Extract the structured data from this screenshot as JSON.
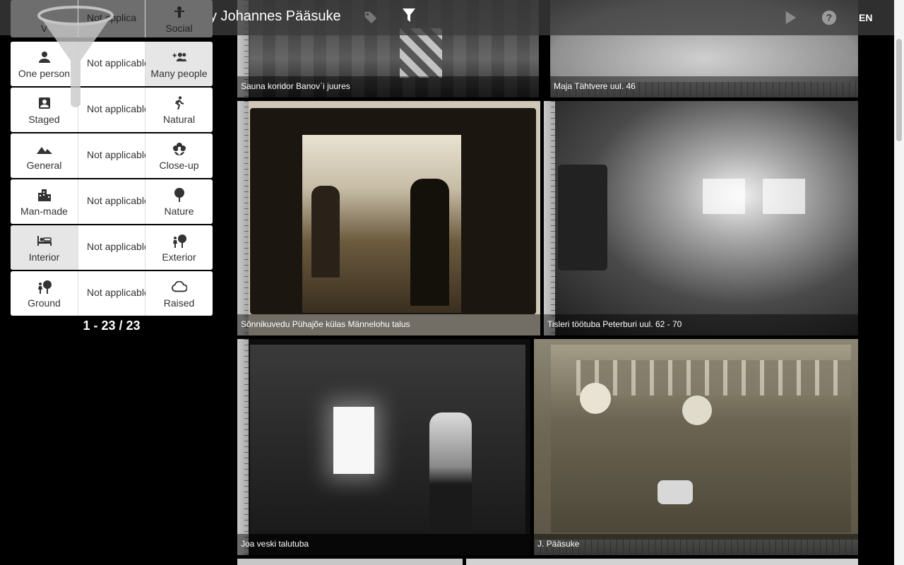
{
  "header": {
    "title": "Photos by Johannes Pääsuke",
    "language": "EN"
  },
  "filters": {
    "rows": [
      {
        "left": "Social",
        "mid": "Not applicable",
        "right": "",
        "left_icon": "groups-icon"
      },
      {
        "left": "One person",
        "mid": "Not applicable",
        "right": "Many people",
        "left_icon": "person-icon",
        "right_icon": "group-add-icon",
        "active": "right"
      },
      {
        "left": "Staged",
        "mid": "Not applicable",
        "right": "Natural",
        "left_icon": "portrait-icon",
        "right_icon": "walking-icon"
      },
      {
        "left": "General",
        "mid": "Not applicable",
        "right": "Close-up",
        "left_icon": "landscape-icon",
        "right_icon": "flower-icon"
      },
      {
        "left": "Man-made",
        "mid": "Not applicable",
        "right": "Nature",
        "left_icon": "city-icon",
        "right_icon": "tree-icon"
      },
      {
        "left": "Interior",
        "mid": "Not applicable",
        "right": "Exterior",
        "left_icon": "bed-icon",
        "right_icon": "nature-people-icon",
        "active": "left"
      },
      {
        "left": "Ground",
        "mid": "Not applicable",
        "right": "Raised",
        "left_icon": "person-tree-icon",
        "right_icon": "cloud-icon"
      }
    ],
    "top_partial": {
      "left": "V",
      "mid": "Not applica",
      "right": "Social"
    },
    "result_count": "1 - 23 / 23"
  },
  "photos": [
    {
      "caption": "Sauna koridor Banov`i juures",
      "tone": "dark"
    },
    {
      "caption": "Maja Tähtvere uul. 46",
      "tone": "light"
    },
    {
      "caption": "Sõnnikuvedu Pühajõe külas Männelohu talus",
      "tone": "sepia"
    },
    {
      "caption": "Tisleri töötuba Peterburi uul. 62 - 70",
      "tone": "gray"
    },
    {
      "caption": "Joa veski talutuba",
      "tone": "dark"
    },
    {
      "caption": "J. Pääsuke",
      "tone": "sepia"
    }
  ],
  "colors": {
    "header_bg": "#3c3c3c",
    "panel_active": "#e6e6e6",
    "sepia": "#8a7a60"
  }
}
